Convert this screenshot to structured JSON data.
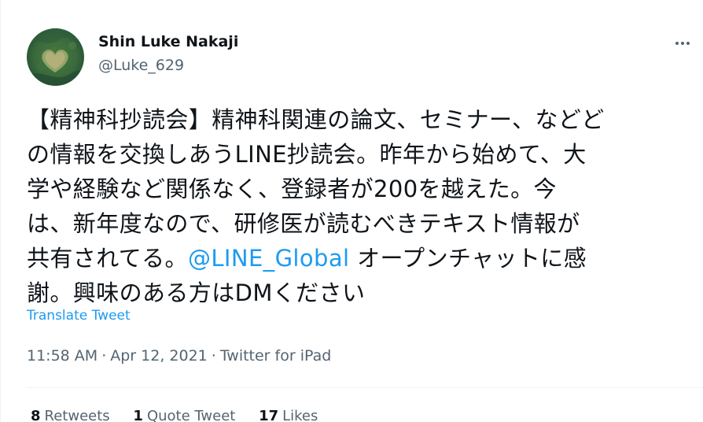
{
  "author": {
    "display_name": "Shin Luke Nakaji",
    "handle": "@Luke_629",
    "avatar_icon": "heart-shaped-island-photo"
  },
  "more_icon": "more-options-icon",
  "tweet": {
    "lines": [
      {
        "text": "【精神科抄読会】精神科関連の論文、セミナー、などど"
      },
      {
        "text": "の情報を交換しあうLINE抄読会。昨年から始めて、大"
      },
      {
        "text": "学や経験など関係なく、登録者が200を越えた。今"
      },
      {
        "text": "は、新年度なので、研修医が読むべきテキスト情報が"
      },
      {
        "before": "共有されてる。",
        "mention": "@LINE_Global",
        "after": " オープンチャットに感"
      },
      {
        "text": "謝。興味のある方はDMください"
      }
    ],
    "translate_label": "Translate Tweet"
  },
  "meta": {
    "time": "11:58 AM",
    "separator": "·",
    "date": "Apr 12, 2021",
    "source": "Twitter for iPad"
  },
  "stats": {
    "retweets_count": "8",
    "retweets_label": "Retweets",
    "quotes_count": "1",
    "quotes_label": "Quote Tweet",
    "likes_count": "17",
    "likes_label": "Likes"
  },
  "colors": {
    "link": "#1d9bf0",
    "secondary_text": "#536471",
    "primary_text": "#0f1419",
    "border": "#eff3f4"
  }
}
